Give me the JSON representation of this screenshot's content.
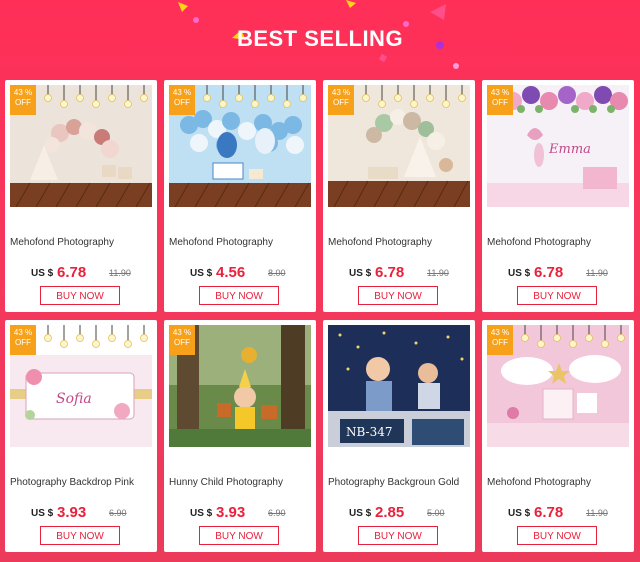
{
  "header": {
    "title": "BEST SELLING"
  },
  "colors": {
    "accent": "#e8213c",
    "badge": "#f7a11a",
    "background": "#f4385c"
  },
  "products": [
    {
      "badge": "43 %\nOFF",
      "name": "Mehofond Photography",
      "currency": "US $",
      "price": "6.78",
      "old_price": "11.90",
      "button": "BUY NOW",
      "image_icon": "balloon-arch-backdrop-photo"
    },
    {
      "badge": "43 %\nOFF",
      "name": "Mehofond Photography",
      "currency": "US $",
      "price": "4.56",
      "old_price": "8.00",
      "button": "BUY NOW",
      "image_icon": "blue-balloon-backdrop-photo"
    },
    {
      "badge": "43 %\nOFF",
      "name": "Mehofond Photography",
      "currency": "US $",
      "price": "6.78",
      "old_price": "11.90",
      "button": "BUY NOW",
      "image_icon": "green-balloon-backdrop-photo"
    },
    {
      "badge": "43 %\nOFF",
      "name": "Mehofond Photography",
      "currency": "US $",
      "price": "6.78",
      "old_price": "11.90",
      "button": "BUY NOW",
      "image_icon": "floral-fairy-backdrop-photo"
    },
    {
      "badge": "43 %\nOFF",
      "name": "Photography Backdrop Pink",
      "currency": "US $",
      "price": "3.93",
      "old_price": "6.90",
      "button": "BUY NOW",
      "image_icon": "pink-floral-birthday-backdrop-photo"
    },
    {
      "badge": "43 %\nOFF",
      "name": "Hunny Child Photography",
      "currency": "US $",
      "price": "3.93",
      "old_price": "6.90",
      "button": "BUY NOW",
      "image_icon": "forest-hunny-backdrop-photo"
    },
    {
      "badge": "",
      "name": "Photography Backgroun Gold",
      "currency": "US $",
      "price": "2.85",
      "old_price": "5.00",
      "button": "BUY NOW",
      "image_icon": "starry-night-backdrop-photo",
      "image_text": "NB-347"
    },
    {
      "badge": "43 %\nOFF",
      "name": "Mehofond Photography",
      "currency": "US $",
      "price": "6.78",
      "old_price": "11.90",
      "button": "BUY NOW",
      "image_icon": "pink-cloud-backdrop-photo"
    }
  ]
}
